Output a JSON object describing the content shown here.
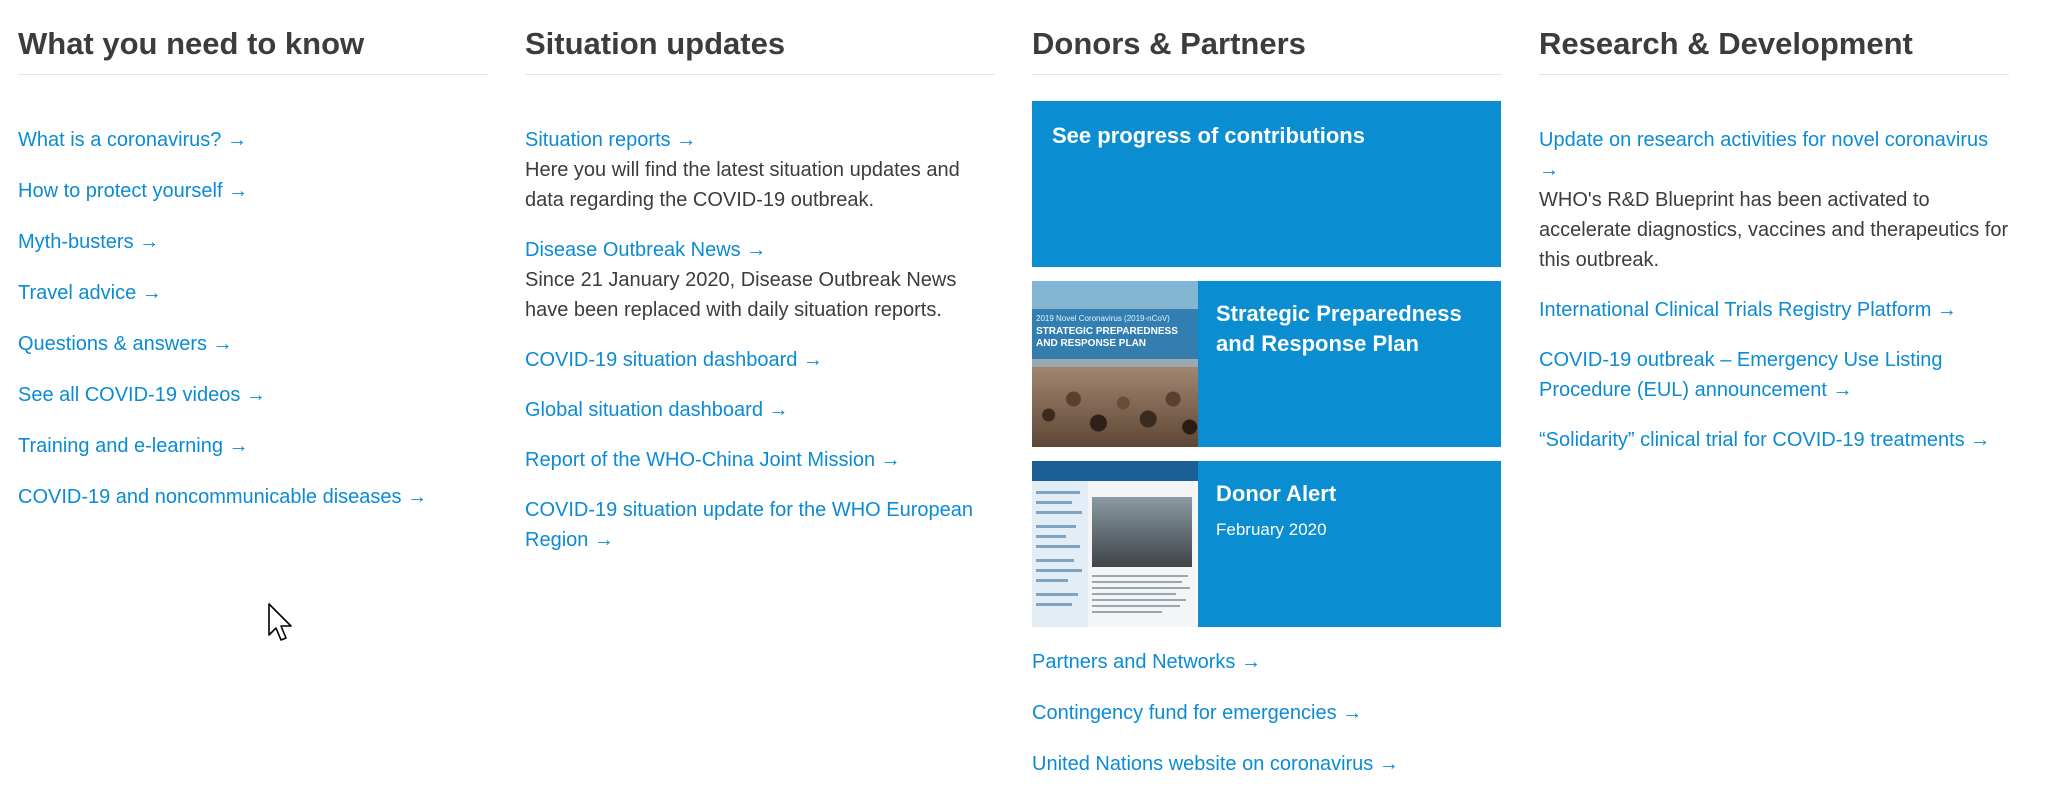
{
  "columns": {
    "know": {
      "heading": "What you need to know",
      "links": [
        "What is a coronavirus? →",
        "How to protect yourself →",
        "Myth-busters →",
        "Travel advice →",
        "Questions & answers →",
        "See all COVID-19 videos →",
        "Training and e-learning →",
        "COVID-19 and noncommunicable diseases →"
      ]
    },
    "situation": {
      "heading": "Situation updates",
      "items": [
        {
          "link": "Situation reports →",
          "desc": "Here you will find the latest situation updates and data regarding the COVID-19 outbreak."
        },
        {
          "link": "Disease Outbreak News →",
          "desc": "Since 21 January 2020, Disease Outbreak News have been replaced with daily situation reports."
        },
        {
          "link": "COVID-19 situation dashboard →",
          "desc": ""
        },
        {
          "link": "Global situation dashboard →",
          "desc": ""
        },
        {
          "link": "Report of the WHO-China Joint Mission →",
          "desc": ""
        },
        {
          "link": "COVID-19 situation update for the WHO European Region  →",
          "desc": ""
        }
      ]
    },
    "donors": {
      "heading": "Donors & Partners",
      "cards": [
        {
          "title": "See progress of contributions",
          "subtitle": ""
        },
        {
          "title": "Strategic Preparedness and Response Plan",
          "subtitle": "",
          "thumb_icon": "strategic-plan-cover"
        },
        {
          "title": "Donor Alert",
          "subtitle": "February 2020",
          "thumb_icon": "donor-alert-cover"
        }
      ],
      "links": [
        "Partners and Networks →",
        "Contingency fund for emergencies →",
        "United Nations website on coronavirus →"
      ],
      "thumb1_text_small": "2019 Novel Coronavirus (2019-nCoV)",
      "thumb1_text_big": "STRATEGIC PREPAREDNESS AND RESPONSE PLAN"
    },
    "research": {
      "heading": "Research & Development",
      "items": [
        {
          "link": "Update on research activities for novel coronavirus →",
          "desc": "WHO's R&D Blueprint has been activated to accelerate diagnostics, vaccines and therapeutics for this outbreak."
        },
        {
          "link": "International Clinical Trials Registry Platform →",
          "desc": ""
        },
        {
          "link": "COVID-19 outbreak – Emergency Use Listing Procedure (EUL) announcement →",
          "desc": ""
        },
        {
          "link": "“Solidarity” clinical trial for COVID-19 treatments →",
          "desc": ""
        }
      ]
    }
  },
  "colors": {
    "link": "#0b8bd3",
    "heading": "#3c3c3c",
    "card_bg": "#0a8ed1"
  },
  "cursor_icon": "mouse-pointer-icon"
}
